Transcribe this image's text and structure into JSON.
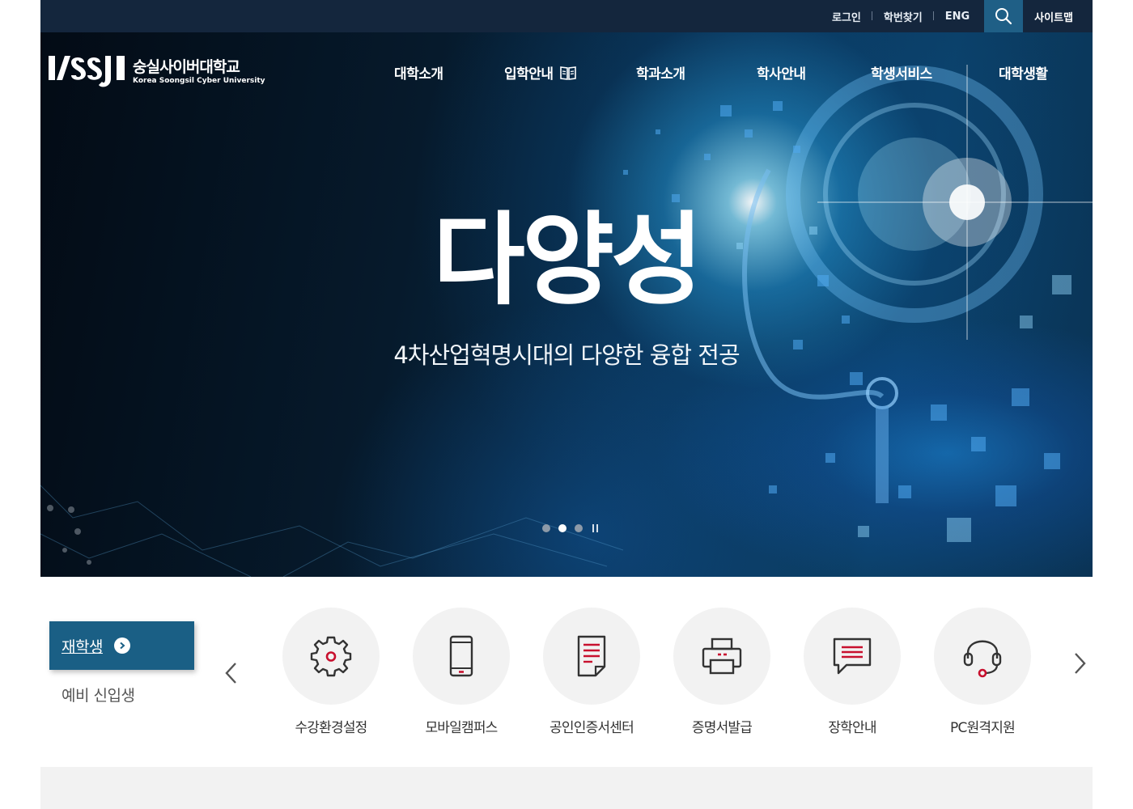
{
  "topbar": {
    "login": "로그인",
    "find_id": "학번찾기",
    "eng": "ENG",
    "sitemap": "사이트맵",
    "search_icon": "search-icon"
  },
  "brand": {
    "name_kr": "숭실사이버대학교",
    "name_en": "Korea Soongsil Cyber University"
  },
  "nav": {
    "items": [
      {
        "label": "대학소개"
      },
      {
        "label": "입학안내",
        "icon": "book-icon"
      },
      {
        "label": "학과소개"
      },
      {
        "label": "학사안내"
      },
      {
        "label": "학생서비스"
      },
      {
        "label": "대학생활"
      }
    ]
  },
  "hero": {
    "title": "다양성",
    "subtitle": "4차산업혁명시대의 다양한 융합 전공",
    "slides": 3,
    "active_slide": 2
  },
  "quick": {
    "tab_current": "재학생",
    "tab_other": "예비 신입생",
    "items": [
      {
        "label": "수강환경설정",
        "icon": "gear-icon"
      },
      {
        "label": "모바일캠퍼스",
        "icon": "mobile-icon"
      },
      {
        "label": "공인인증서센터",
        "icon": "document-icon"
      },
      {
        "label": "증명서발급",
        "icon": "printer-icon"
      },
      {
        "label": "장학안내",
        "icon": "chat-icon"
      },
      {
        "label": "PC원격지원",
        "icon": "headset-icon"
      }
    ]
  },
  "colors": {
    "topbar": "#14263d",
    "search_bg": "#1f5f86",
    "tab_active": "#1a5f85",
    "icon_red": "#c8102e",
    "icon_dark": "#333333",
    "circle_bg": "#f2f2f2"
  }
}
